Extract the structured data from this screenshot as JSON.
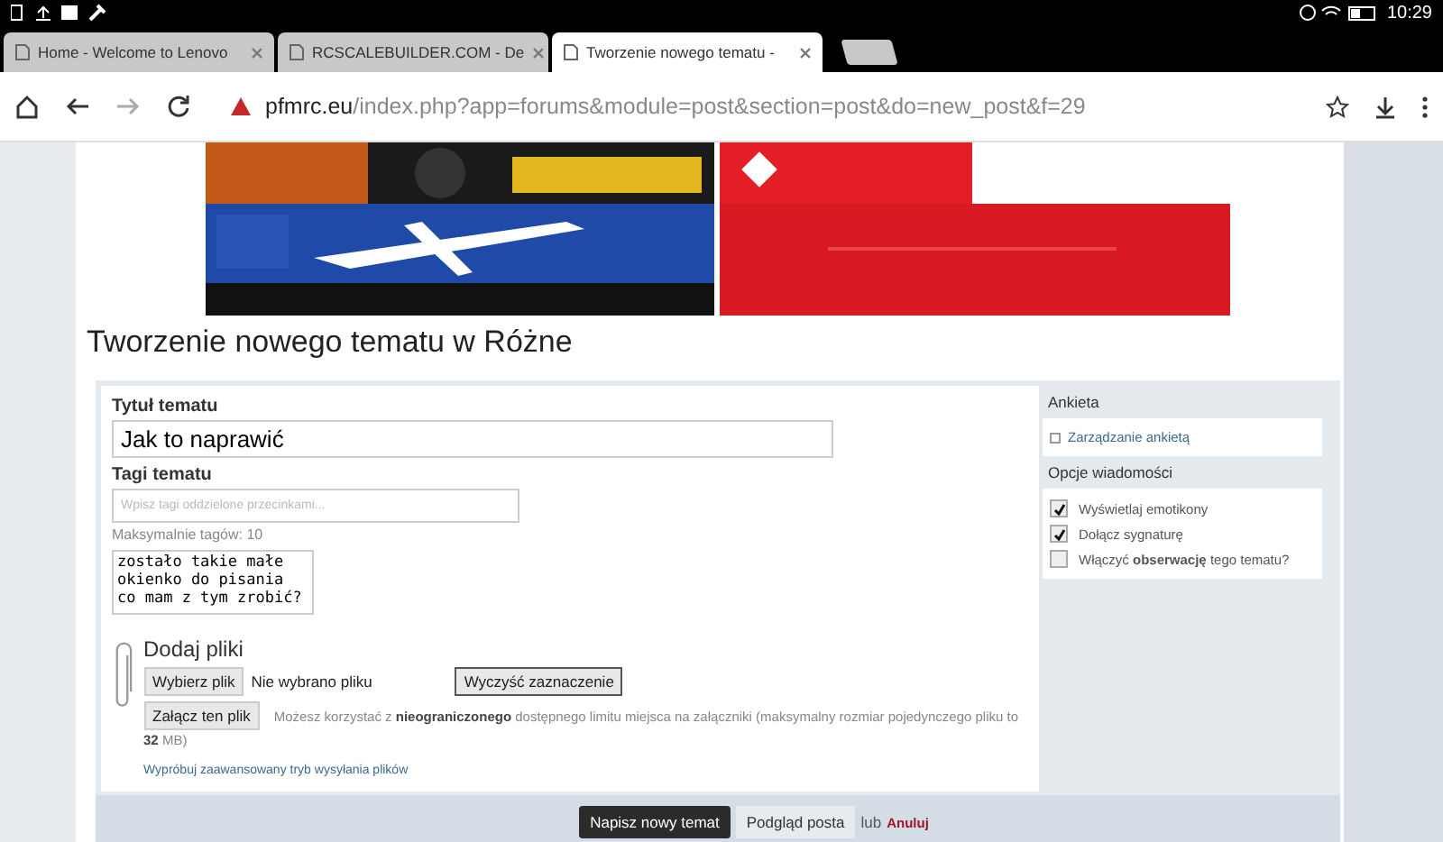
{
  "status_bar": {
    "time": "10:29"
  },
  "tabs": [
    {
      "title": "Home - Welcome to Lenovo",
      "selected": false
    },
    {
      "title": "RCSCALEBUILDER.COM - De",
      "selected": false
    },
    {
      "title": "Tworzenie nowego tematu -",
      "selected": true
    }
  ],
  "address_bar": {
    "host": "pfmrc.eu",
    "path": "/index.php?app=forums&module=post&section=post&do=new_post&f=29"
  },
  "page_title": "Tworzenie nowego tematu w Różne",
  "form": {
    "title_label": "Tytuł tematu",
    "title_value": "Jak to naprawić",
    "tags_label": "Tagi tematu",
    "tags_placeholder": "Wpisz tagi oddzielone przecinkami...",
    "tags_hint": "Maksymalnie tagów: 10",
    "message_lines": [
      "zostało takie małe",
      "okienko do pisania",
      "co mam z tym zrobić?"
    ],
    "attach_title": "Dodaj pliki",
    "choose_button": "Wybierz plik",
    "no_file": "Nie wybrano pliku",
    "clear_button": "Wyczyść zaznaczenie",
    "attach_button": "Załącz ten plik",
    "limit_text": "Możesz korzystać z **nieograniczonego** dostępnego limitu miejsca na załączniki (maksymalny rozmiar pojedynczego pliku to **32** MB)",
    "advanced_link": "Wypróbuj zaawansowany tryb wysyłania plików"
  },
  "sidebar": {
    "poll_title": "Ankieta",
    "poll_link": "Zarządzanie ankietą",
    "options_title": "Opcje wiadomości",
    "options": [
      {
        "label": "Wyświetlaj emotikony",
        "checked": true
      },
      {
        "label": "Dołącz sygnaturę",
        "checked": true
      },
      {
        "label": "Włączyć **obserwację** tego tematu?",
        "checked": false
      }
    ]
  },
  "actions": {
    "submit": "Napisz nowy temat",
    "preview": "Podgląd posta",
    "or": "lub",
    "cancel": "Anuluj"
  }
}
